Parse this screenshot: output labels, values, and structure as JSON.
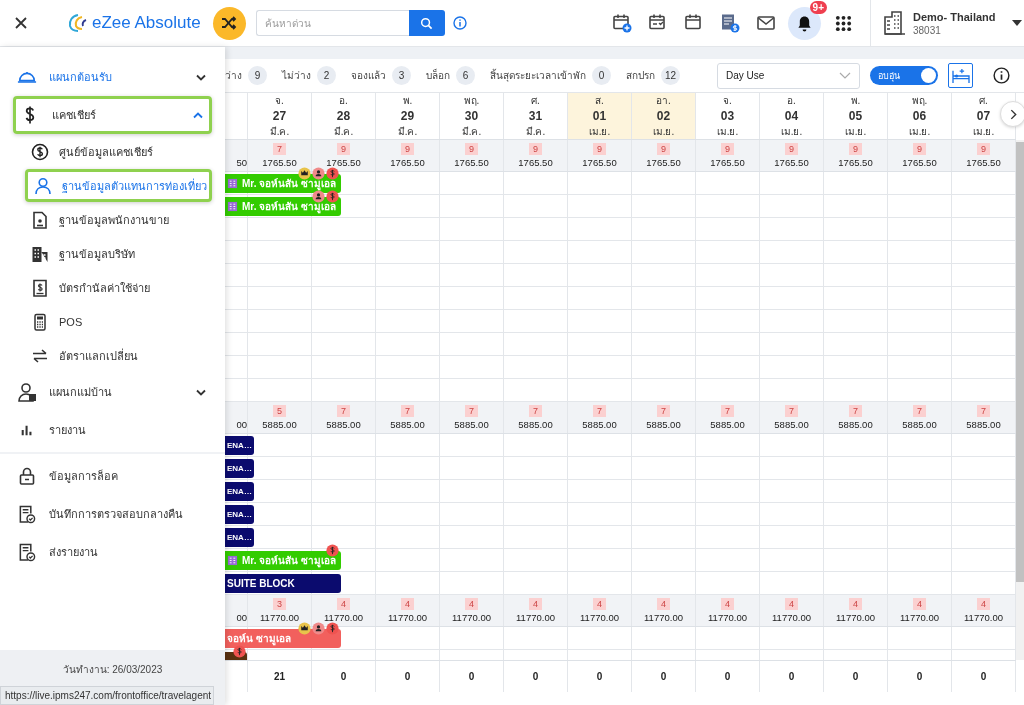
{
  "topbar": {
    "app_name": "eZee Absolute",
    "search": {
      "placeholder": "ค้นหาด่วน"
    },
    "notification_badge": "9+",
    "property": {
      "name": "Demo- Thailand",
      "code": "38031"
    }
  },
  "sidebar": {
    "groups": [
      {
        "items": [
          {
            "label": "แผนกต้อนรับ",
            "selected": true,
            "highlighted": false,
            "expanded": false
          },
          {
            "label": "แคชเชียร์",
            "selected": false,
            "highlighted": true,
            "expanded": true,
            "children": [
              {
                "label": "ศูนย์ข้อมูลแคชเชียร์",
                "selected": false,
                "highlighted": false
              },
              {
                "label": "ฐานข้อมูลตัวแทนการท่องเที่ยว",
                "selected": true,
                "highlighted": true
              },
              {
                "label": "ฐานข้อมูลพนักงานขาย",
                "selected": false,
                "highlighted": false
              },
              {
                "label": "ฐานข้อมูลบริษัท",
                "selected": false,
                "highlighted": false
              },
              {
                "label": "บัตรกำนัลค่าใช้จ่าย",
                "selected": false,
                "highlighted": false
              },
              {
                "label": "POS",
                "selected": false,
                "highlighted": false
              },
              {
                "label": "อัตราแลกเปลี่ยน",
                "selected": false,
                "highlighted": false
              }
            ]
          },
          {
            "label": "แผนกแม่บ้าน",
            "selected": false,
            "highlighted": false,
            "expanded": false
          },
          {
            "label": "รายงาน",
            "selected": false,
            "highlighted": false
          }
        ]
      },
      {
        "items": [
          {
            "label": "ข้อมูลการล็อค",
            "selected": false,
            "highlighted": false
          },
          {
            "label": "บันทึกการตรวจสอบกลางคืน",
            "selected": false,
            "highlighted": false
          },
          {
            "label": "ส่งรายงาน",
            "selected": false,
            "highlighted": false
          }
        ]
      }
    ],
    "work_date": "วันทำงาน: 26/03/2023"
  },
  "status_url": "https://live.ipms247.com/frontoffice/travelagent",
  "stats": [
    {
      "label": "ว่าง",
      "count": "9"
    },
    {
      "label": "ไม่ว่าง",
      "count": "2"
    },
    {
      "label": "จองแล้ว",
      "count": "3"
    },
    {
      "label": "บล็อก",
      "count": "6"
    },
    {
      "label": "สิ้นสุดระยะเวลาเข้าพัก",
      "count": "0"
    },
    {
      "label": "สกปรก",
      "count": "12"
    }
  ],
  "view_select": "Day Use",
  "toggle": {
    "label": "อบอุ่น",
    "on": true
  },
  "calendar": {
    "days": [
      {
        "dow": "จ.",
        "day": "27",
        "month": "มี.ค.",
        "weekend": false
      },
      {
        "dow": "อ.",
        "day": "28",
        "month": "มี.ค.",
        "weekend": false
      },
      {
        "dow": "พ.",
        "day": "29",
        "month": "มี.ค.",
        "weekend": false
      },
      {
        "dow": "พฤ.",
        "day": "30",
        "month": "มี.ค.",
        "weekend": false
      },
      {
        "dow": "ศ.",
        "day": "31",
        "month": "มี.ค.",
        "weekend": false
      },
      {
        "dow": "ส.",
        "day": "01",
        "month": "เม.ย.",
        "weekend": true
      },
      {
        "dow": "อา.",
        "day": "02",
        "month": "เม.ย.",
        "weekend": true
      },
      {
        "dow": "จ.",
        "day": "03",
        "month": "เม.ย.",
        "weekend": false
      },
      {
        "dow": "อ.",
        "day": "04",
        "month": "เม.ย.",
        "weekend": false
      },
      {
        "dow": "พ.",
        "day": "05",
        "month": "เม.ย.",
        "weekend": false
      },
      {
        "dow": "พฤ.",
        "day": "06",
        "month": "เม.ย.",
        "weekend": false
      },
      {
        "dow": "ศ.",
        "day": "07",
        "month": "เม.ย.",
        "weekend": false
      }
    ],
    "sections": [
      {
        "lead_price": "50",
        "counts": [
          "7",
          "9",
          "9",
          "9",
          "9",
          "9",
          "9",
          "9",
          "9",
          "9",
          "9",
          "9"
        ],
        "prices": [
          "1765.50",
          "1765.50",
          "1765.50",
          "1765.50",
          "1765.50",
          "1765.50",
          "1765.50",
          "1765.50",
          "1765.50",
          "1765.50",
          "1765.50",
          "1765.50"
        ],
        "rows": [
          {
            "booking": {
              "kind": "guest",
              "color": "#33cc00",
              "label": "Mr. จอห์นสัน ซามูเอล",
              "badges": [
                {
                  "kind": "crown"
                },
                {
                  "kind": "person"
                },
                {
                  "kind": "dollar"
                }
              ]
            }
          },
          {
            "booking": {
              "kind": "guest",
              "color": "#33cc00",
              "label": "Mr. จอห์นสัน ซามูเอล",
              "badges": [
                {
                  "kind": "person"
                },
                {
                  "kind": "dollar"
                }
              ]
            }
          },
          {
            "booking": null
          },
          {
            "booking": null
          },
          {
            "booking": null
          },
          {
            "booking": null
          },
          {
            "booking": null
          },
          {
            "booking": null
          },
          {
            "booking": null
          },
          {
            "booking": null
          }
        ]
      },
      {
        "lead_price": "00",
        "counts": [
          "5",
          "7",
          "7",
          "7",
          "7",
          "7",
          "7",
          "7",
          "7",
          "7",
          "7",
          "7"
        ],
        "prices": [
          "5885.00",
          "5885.00",
          "5885.00",
          "5885.00",
          "5885.00",
          "5885.00",
          "5885.00",
          "5885.00",
          "5885.00",
          "5885.00",
          "5885.00",
          "5885.00"
        ],
        "rows": [
          {
            "booking": {
              "kind": "short",
              "color": "#0b0b6e",
              "label": "ENA…"
            }
          },
          {
            "booking": {
              "kind": "short",
              "color": "#0b0b6e",
              "label": "ENA…"
            }
          },
          {
            "booking": {
              "kind": "short",
              "color": "#0b0b6e",
              "label": "ENA…"
            }
          },
          {
            "booking": {
              "kind": "short",
              "color": "#0b0b6e",
              "label": "ENA…"
            }
          },
          {
            "booking": {
              "kind": "short",
              "color": "#0b0b6e",
              "label": "ENA…"
            }
          },
          {
            "booking": {
              "kind": "guest",
              "color": "#33cc00",
              "label": "Mr. จอห์นสัน ซามูเอล",
              "badges": [
                {
                  "kind": "dollar"
                }
              ]
            }
          },
          {
            "booking": {
              "kind": "block",
              "color": "#0b0b6e",
              "label": "SUITE BLOCK"
            }
          }
        ]
      },
      {
        "lead_price": "00",
        "counts": [
          "3",
          "4",
          "4",
          "4",
          "4",
          "4",
          "4",
          "4",
          "4",
          "4",
          "4",
          "4"
        ],
        "prices": [
          "11770.00",
          "11770.00",
          "11770.00",
          "11770.00",
          "11770.00",
          "11770.00",
          "11770.00",
          "11770.00",
          "11770.00",
          "11770.00",
          "11770.00",
          "11770.00"
        ],
        "rows": [
          {
            "booking": {
              "kind": "block",
              "color": "#f2605d",
              "label": "จอห์น ซามูเอล",
              "badges": [
                {
                  "kind": "crown"
                },
                {
                  "kind": "person"
                },
                {
                  "kind": "dollar"
                }
              ]
            }
          },
          {
            "booking": {
              "kind": "short",
              "color": "#5a3210",
              "badges": [
                {
                  "kind": "dollar"
                }
              ]
            }
          }
        ]
      }
    ],
    "totals": [
      "21",
      "0",
      "0",
      "0",
      "0",
      "0",
      "0",
      "0",
      "0",
      "0",
      "0",
      "0"
    ]
  }
}
